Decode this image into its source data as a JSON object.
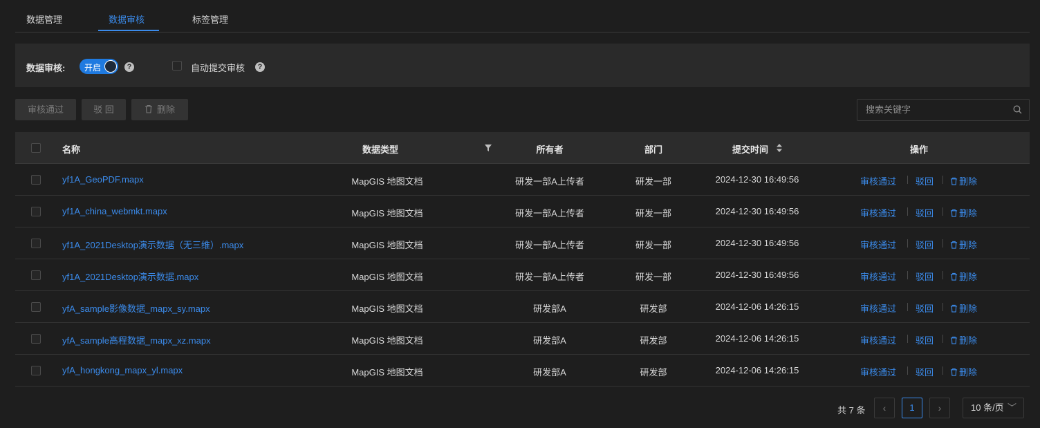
{
  "tabs": [
    {
      "label": "数据管理"
    },
    {
      "label": "数据审核",
      "active": true
    },
    {
      "label": "标签管理"
    }
  ],
  "settings": {
    "review_label": "数据审核:",
    "switch_text": "开启",
    "switch_on": true,
    "auto_submit_label": "自动提交审核",
    "help_glyph": "?"
  },
  "toolbar": {
    "approve_label": "审核通过",
    "reject_label": "驳 回",
    "delete_label": "删除"
  },
  "search": {
    "placeholder": "搜索关键字"
  },
  "table": {
    "headers": {
      "name": "名称",
      "type": "数据类型",
      "owner": "所有者",
      "dept": "部门",
      "time": "提交时间",
      "ops": "操作"
    },
    "rows": [
      {
        "name": "yf1A_GeoPDF.mapx",
        "type": "MapGIS 地图文档",
        "owner": "研发一部A上传者",
        "dept": "研发一部",
        "time": "2024-12-30 16:49:56"
      },
      {
        "name": "yf1A_china_webmkt.mapx",
        "type": "MapGIS 地图文档",
        "owner": "研发一部A上传者",
        "dept": "研发一部",
        "time": "2024-12-30 16:49:56"
      },
      {
        "name": "yf1A_2021Desktop演示数据（无三维）.mapx",
        "type": "MapGIS 地图文档",
        "owner": "研发一部A上传者",
        "dept": "研发一部",
        "time": "2024-12-30 16:49:56"
      },
      {
        "name": "yf1A_2021Desktop演示数据.mapx",
        "type": "MapGIS 地图文档",
        "owner": "研发一部A上传者",
        "dept": "研发一部",
        "time": "2024-12-30 16:49:56"
      },
      {
        "name": "yfA_sample影像数据_mapx_sy.mapx",
        "type": "MapGIS 地图文档",
        "owner": "研发部A",
        "dept": "研发部",
        "time": "2024-12-06 14:26:15"
      },
      {
        "name": "yfA_sample高程数据_mapx_xz.mapx",
        "type": "MapGIS 地图文档",
        "owner": "研发部A",
        "dept": "研发部",
        "time": "2024-12-06 14:26:15"
      },
      {
        "name": "yfA_hongkong_mapx_yl.mapx",
        "type": "MapGIS 地图文档",
        "owner": "研发部A",
        "dept": "研发部",
        "time": "2024-12-06 14:26:15"
      }
    ],
    "row_actions": {
      "approve": "审核通过",
      "reject": "驳回",
      "delete": "删除"
    }
  },
  "pagination": {
    "total_text": "共 7 条",
    "prev": "‹",
    "next": "›",
    "current_page": "1",
    "page_size": "10 条/页",
    "page_size_chevron": "﹀"
  },
  "colors": {
    "accent": "#3b8beb",
    "background": "#1e1e1e",
    "panel": "#2a2a2a"
  }
}
